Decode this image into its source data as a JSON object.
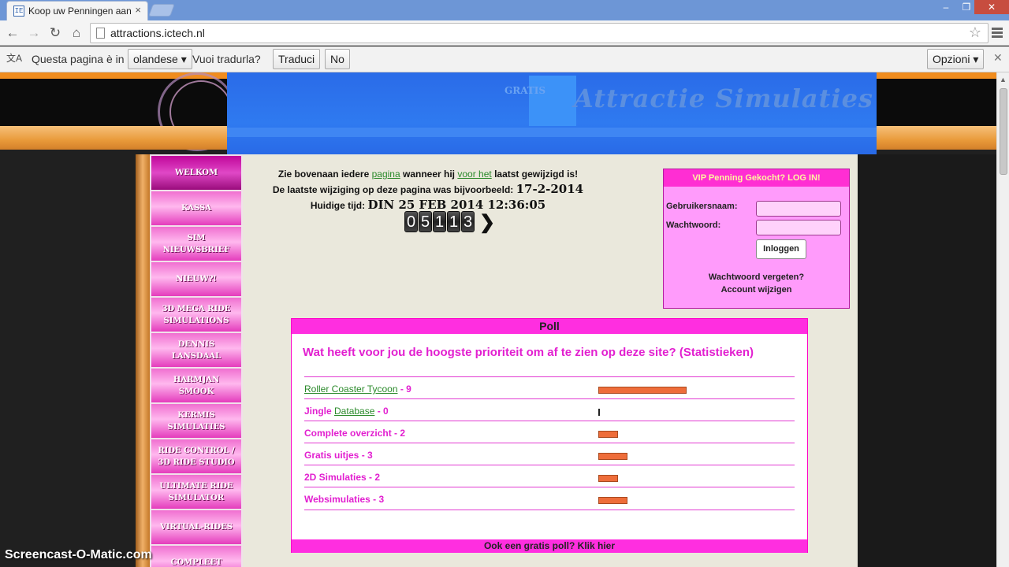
{
  "browser": {
    "tab_title": "Koop uw Penningen aan d",
    "tab_favicon": "IE",
    "url": "attractions.ictech.nl",
    "translate_bar": {
      "question": "Questa pagina è in",
      "language": "olandese",
      "ask": "Vuoi tradurla?",
      "translate_label": "Traduci",
      "no_label": "No",
      "options_label": "Opzioni"
    }
  },
  "banner": {
    "gratis": "GRATIS",
    "title": "Attractie Simulaties"
  },
  "nav": {
    "items": [
      {
        "label": "WELKOM",
        "active": true
      },
      {
        "label": "KASSA"
      },
      {
        "label": "SIM NIEUWSBRIEF"
      },
      {
        "label": "NIEUW?!"
      },
      {
        "label": "3D MEGA RIDE SIMULATIONS"
      },
      {
        "label": "DENNIS LANSDAAL"
      },
      {
        "label": "HARMJAN SMOOK"
      },
      {
        "label": "KERMIS SIMULATIES"
      },
      {
        "label": "RIDE CONTROL / 3D RIDE STUDIO"
      },
      {
        "label": "ULTIMATE RIDE SIMULATOR"
      },
      {
        "label": "VIRTUAL-RIDES"
      },
      {
        "label": "COMPLEET"
      }
    ]
  },
  "info": {
    "line1_pre": "Zie bovenaan iedere",
    "line1_link1": "pagina",
    "line1_mid": "wanneer hij",
    "line1_link2": "voor het",
    "line1_post": "laatst gewijzigd is!",
    "line2_label": "De laatste wijziging op deze pagina was bijvoorbeeld:",
    "line2_date": "17-2-2014",
    "line3_label": "Huidige tijd:",
    "line3_time": "DIN 25 FEB 2014 12:36:05",
    "counter_digits": [
      "0",
      "5",
      "1",
      "1",
      "3"
    ]
  },
  "login": {
    "header": "VIP Penning Gekocht? LOG IN!",
    "username_label": "Gebruikersnaam:",
    "password_label": "Wachtwoord:",
    "login_button": "Inloggen",
    "forgot": "Wachtwoord vergeten?",
    "change": "Account wijzigen"
  },
  "poll": {
    "header": "Poll",
    "question": "Wat heeft voor jou de hoogste prioriteit om af te zien op deze site? (Statistieken)",
    "max_votes": 9,
    "options": [
      {
        "link": "Roller Coaster Tycoon",
        "pre": "",
        "post": " - 9",
        "votes": 9
      },
      {
        "pre": "Jingle ",
        "link": "Database",
        "post": " - 0",
        "votes": 0
      },
      {
        "pre": "Complete overzicht - 2",
        "link": "",
        "post": "",
        "votes": 2
      },
      {
        "pre": "Gratis uitjes - 3",
        "link": "",
        "post": "",
        "votes": 3
      },
      {
        "pre": "2D Simulaties - 2",
        "link": "",
        "post": "",
        "votes": 2
      },
      {
        "pre": "Websimulaties - 3",
        "link": "",
        "post": "",
        "votes": 3
      }
    ],
    "footer": "Ook een gratis poll? Klik hier"
  },
  "watermark": "Screencast-O-Matic.com"
}
